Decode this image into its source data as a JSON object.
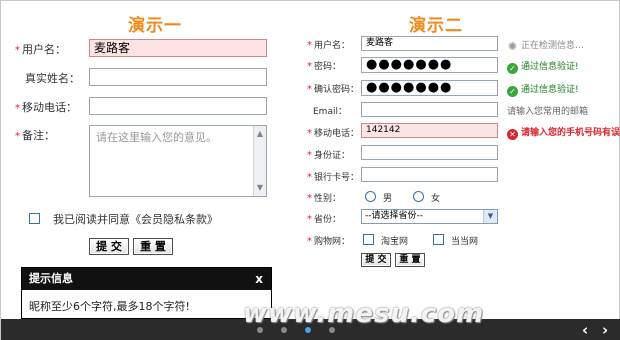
{
  "left": {
    "title": "演示一",
    "username_label": "用户名：",
    "username_value": "麦路客",
    "realname_label": "真实姓名：",
    "phone_label": "移动电话：",
    "note_label": "备注：",
    "note_placeholder": "请在这里输入您的意见。",
    "agree_text": "我已阅读并同意《会员隐私条款》",
    "submit_label": "提 交",
    "reset_label": "重 置"
  },
  "tip": {
    "title": "提示信息",
    "close": "x",
    "message": "昵称至少6个字符,最多18个字符!"
  },
  "right": {
    "title": "演示二",
    "username_label": "用户名：",
    "username_value": "麦路客",
    "username_status": "正在检测信息…",
    "password_label": "密码：",
    "password_value": "●●●●●●●",
    "password_status": "通过信息验证!",
    "confirm_label": "确认密码：",
    "confirm_value": "●●●●●●●",
    "confirm_status": "通过信息验证!",
    "email_label": "Email：",
    "email_hint": "请输入您常用的邮箱",
    "mobile_label": "移动电话：",
    "mobile_value": "142142",
    "mobile_error": "请输入您的手机号码有误!",
    "id_label": "身份证：",
    "bank_label": "银行卡号：",
    "gender_label": "性别：",
    "gender_male": "男",
    "gender_female": "女",
    "province_label": "省份：",
    "province_selected": "--请选择省份--",
    "shop_label": "购物网：",
    "shop_taobao": "淘宝网",
    "shop_dangdang": "当当网",
    "submit_label": "提 交",
    "reset_label": "重 置"
  },
  "footer": {
    "prev": "‹",
    "next": "›",
    "watermark": "www.mesu.com"
  },
  "icons": {
    "ok": "check-circle-icon",
    "error": "x-circle-icon",
    "loading": "spinner-icon"
  },
  "colors": {
    "title": "#f08a1c",
    "required": "#d8262e",
    "ok": "#1d7b20",
    "error_bg": "#fde4e4"
  }
}
